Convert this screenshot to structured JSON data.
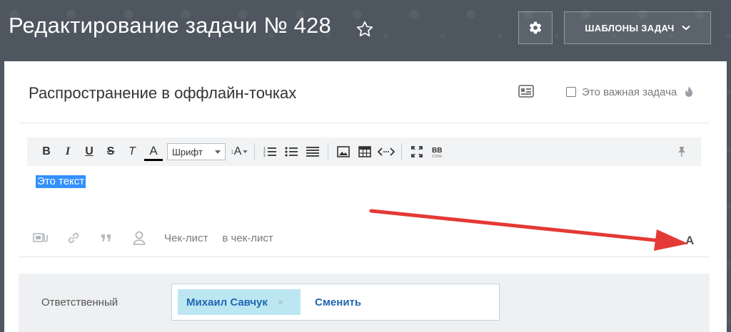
{
  "header": {
    "title": "Редактирование задачи № 428",
    "templates_label": "ШАБЛОНЫ ЗАДАЧ"
  },
  "task": {
    "title": "Распространение в оффлайн-точках",
    "important_label": "Это важная задача",
    "important_checked": false
  },
  "toolbar": {
    "bold": "B",
    "italic": "I",
    "underline": "U",
    "strike": "S",
    "clear_format": "T",
    "text_color": "A",
    "font_select": "Шрифт",
    "font_size": "A"
  },
  "editor": {
    "content": "Это текст"
  },
  "bottom_tools": {
    "checklist": "Чек-лист",
    "to_checklist": "в чек-лист",
    "text_toggle": "A"
  },
  "responsible": {
    "label": "Ответственный",
    "person": "Михаил Савчук",
    "remove": "×",
    "change": "Сменить"
  },
  "colors": {
    "background": "#4e5660",
    "accent": "#2067b0",
    "chip": "#bde6f3",
    "arrow": "#e53935",
    "selection": "#3390ff"
  }
}
